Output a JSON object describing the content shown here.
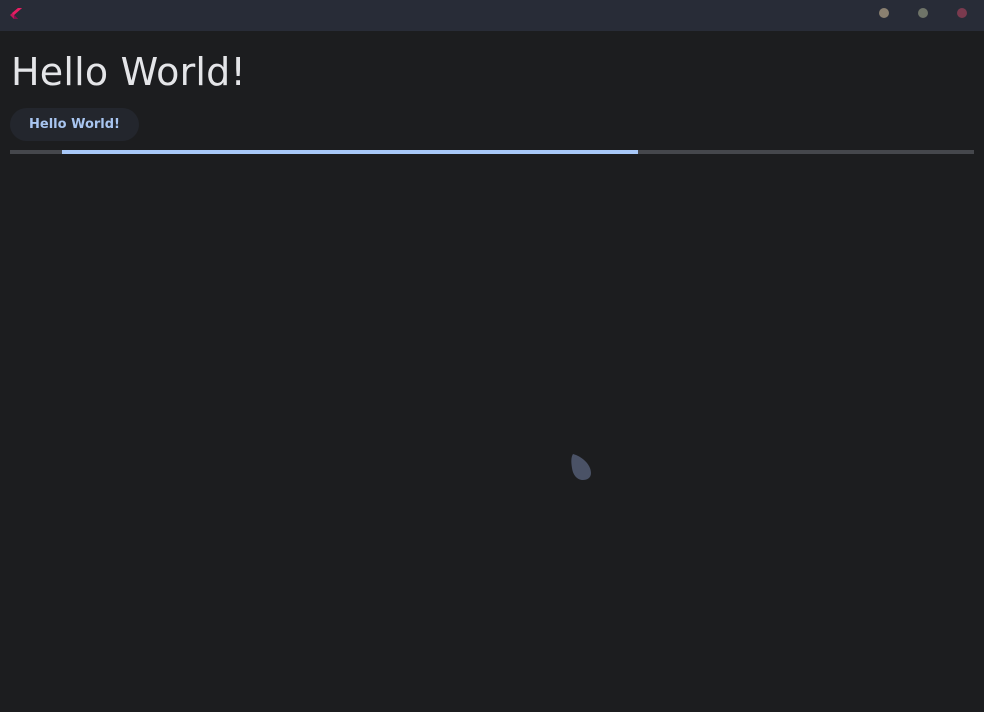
{
  "window": {
    "logo_icon": "flutter-logo-icon",
    "controls": [
      {
        "name": "minimize",
        "color": "#8a8070"
      },
      {
        "name": "maximize",
        "color": "#6f7468"
      },
      {
        "name": "close",
        "color": "#7a3a4e"
      }
    ]
  },
  "main": {
    "title": "Hello World!",
    "button_label": "Hello World!",
    "progress": {
      "mode": "indeterminate",
      "segment_start_fraction": 0.054,
      "segment_end_fraction": 0.652,
      "track_color": "#45474c",
      "indicator_color": "#a8c8f8"
    },
    "spinner_icon": "loading-spinner-icon"
  },
  "colors": {
    "background": "#1c1d1f",
    "titlebar": "#282c37",
    "title_text": "#e4e5e8",
    "button_bg": "#23262d",
    "button_text": "#a8c5f0",
    "spinner": "#4a5266"
  }
}
